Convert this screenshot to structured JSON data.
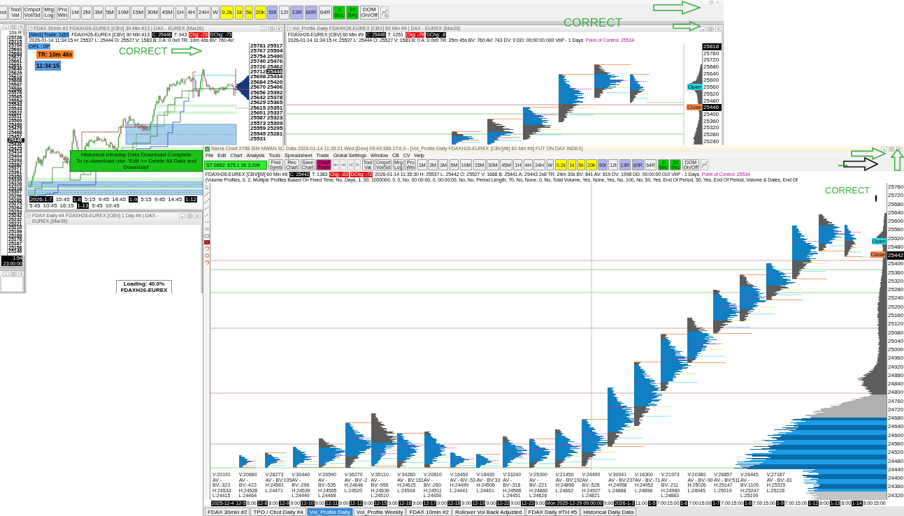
{
  "app_toolbar": {
    "buttons": [
      {
        "label": "nd",
        "color": "#f0f0f0"
      },
      {
        "label": "Tool Val",
        "color": "#f0f0f0"
      },
      {
        "label": "Cmpct Vol/Sd",
        "color": "#f0f0f0"
      },
      {
        "label": "Mrg Log",
        "color": "#f0f0f0"
      },
      {
        "label": "Pro Win",
        "color": "#f0f0f0"
      },
      {
        "label": "1M",
        "color": "#f0f0f0"
      },
      {
        "label": "2M",
        "color": "#f0f0f0"
      },
      {
        "label": "3M",
        "color": "#f0f0f0"
      },
      {
        "label": "5M",
        "color": "#f0f0f0"
      },
      {
        "label": "10M",
        "color": "#f0f0f0"
      },
      {
        "label": "15M",
        "color": "#f0f0f0"
      },
      {
        "label": "30M",
        "color": "#f0f0f0"
      },
      {
        "label": "45M",
        "color": "#f0f0f0"
      },
      {
        "label": "1H",
        "color": "#f0f0f0"
      },
      {
        "label": "4H",
        "color": "#f0f0f0"
      },
      {
        "label": "24H",
        "color": "#f0f0f0"
      },
      {
        "label": "W",
        "color": "#f0f0f0"
      },
      {
        "label": "0.2k",
        "color": "#ffff00"
      },
      {
        "label": "1k",
        "color": "#ffff00"
      },
      {
        "label": "5k",
        "color": "#ffff00"
      },
      {
        "label": "20k",
        "color": "#ffff00"
      },
      {
        "label": "50t",
        "color": "#b4b4f0"
      },
      {
        "label": "12t",
        "color": "#f0f0f0"
      },
      {
        "label": "13R",
        "color": "#b4b4f0"
      },
      {
        "label": "60R",
        "color": "#b4b4f0"
      },
      {
        "label": "64R",
        "color": "#f0f0f0"
      },
      {
        "label": "3 Sec",
        "color": "#00d000"
      },
      {
        "label": "10 Sec",
        "color": "#00d000"
      },
      {
        "label": "DOM On/Off",
        "color": "#f0f0f0"
      }
    ]
  },
  "ladder_window": {
    "header": "10s R",
    "prices": [
      {
        "label": "25726",
        "highlighted": false
      },
      {
        "label": "25715",
        "highlighted": false
      },
      {
        "label": "25704",
        "highlighted": false
      },
      {
        "label": "25693",
        "highlighted": false
      },
      {
        "label": "25683",
        "highlighted": false
      },
      {
        "label": "25672",
        "highlighted": false
      },
      {
        "label": "25661",
        "highlighted": false
      },
      {
        "label": "25651",
        "highlighted": false
      },
      {
        "label": "25640",
        "highlighted": false
      },
      {
        "label": "25629",
        "highlighted": false
      },
      {
        "label": "25619",
        "highlighted": false
      },
      {
        "label": "25608",
        "highlighted": false
      },
      {
        "label": "25597",
        "highlighted": false
      },
      {
        "label": "25586",
        "highlighted": false
      },
      {
        "label": "25576",
        "highlighted": false
      },
      {
        "label": "25565",
        "highlighted": false
      },
      {
        "label": "25554",
        "highlighted": false
      },
      {
        "label": "25543",
        "highlighted": false
      },
      {
        "label": "25533",
        "highlighted": false
      },
      {
        "label": "25522",
        "highlighted": false
      },
      {
        "label": "25511",
        "highlighted": false
      },
      {
        "label": "25500",
        "highlighted": false
      },
      {
        "label": "25490",
        "highlighted": false
      },
      {
        "label": "25479",
        "highlighted": false
      },
      {
        "label": "25468",
        "highlighted": false
      },
      {
        "label": "25457",
        "highlighted": false
      },
      {
        "label": "25446",
        "highlighted": true
      },
      {
        "label": "25436",
        "highlighted": false
      },
      {
        "label": "25425",
        "highlighted": false
      },
      {
        "label": "25414",
        "highlighted": false
      },
      {
        "label": "25404",
        "highlighted": false
      },
      {
        "label": "25393",
        "highlighted": false
      },
      {
        "label": "25382",
        "highlighted": false
      },
      {
        "label": "25371",
        "highlighted": false
      },
      {
        "label": "25361",
        "highlighted": false
      },
      {
        "label": "25350",
        "highlighted": false
      },
      {
        "label": "25339",
        "highlighted": false
      },
      {
        "label": "25328",
        "highlighted": false
      },
      {
        "label": "25318",
        "highlighted": false
      },
      {
        "label": "25307",
        "highlighted": false
      },
      {
        "label": "25296",
        "highlighted": false
      },
      {
        "label": "25285",
        "highlighted": false
      },
      {
        "label": "25275",
        "highlighted": false
      },
      {
        "label": "25264",
        "highlighted": false
      },
      {
        "label": "25253",
        "highlighted": false
      },
      {
        "label": "25242",
        "highlighted": false
      },
      {
        "label": "25232",
        "highlighted": false
      },
      {
        "label": "25221",
        "highlighted": false
      },
      {
        "label": "25210",
        "highlighted": false
      },
      {
        "label": "25199",
        "highlighted": false
      },
      {
        "label": "25189",
        "highlighted": false
      },
      {
        "label": "25178",
        "highlighted": false
      },
      {
        "label": "25167",
        "highlighted": false
      },
      {
        "label": "25156",
        "highlighted": false
      },
      {
        "label": "25146",
        "highlighted": false
      }
    ],
    "footer": "1:54 23:00:00"
  },
  "chart_window": {
    "title": "FDAX 30min #2 FDAXH26-EUREX [CBV]  30 Min #13 | DAX - EUREX (Mar26)",
    "header": [
      {
        "kind": "account",
        "text": "[Sim1]  Trade: 1@0"
      },
      {
        "kind": "text",
        "text": "FDAXH26-EUREX [CBV]  30 Min #13"
      },
      {
        "kind": "price",
        "text": "C: 25446"
      },
      {
        "kind": "text",
        "text": "T: 943"
      },
      {
        "kind": "change",
        "text": "Chg: -73"
      },
      {
        "kind": "price",
        "text": "DChg: -73"
      },
      {
        "kind": "text",
        "text": "2026-01-14 11:34:15 H: 25537 L: 25444 O: 25527 V: 1583 B: 0 A: 0 0x0 TR: 10m 46s BV: 760 AV:"
      }
    ],
    "account_pnl": "OPL: 0P",
    "timer": "TR: 10m 46s",
    "clock": "11:34:15",
    "notice": [
      "Historical Intraday Data Download Complete",
      "To re-download use: 'Edit >> Delete All Data and Download'"
    ],
    "price_axis": [
      {
        "label": "25781",
        "highlighted": false
      },
      {
        "label": "25767",
        "highlighted": false
      },
      {
        "label": "25754",
        "highlighted": false
      },
      {
        "label": "25740",
        "highlighted": false
      },
      {
        "label": "25726",
        "highlighted": false
      },
      {
        "label": "25712",
        "highlighted": false
      },
      {
        "label": "25698",
        "highlighted": false
      },
      {
        "label": "25684",
        "highlighted": false
      },
      {
        "label": "25670",
        "highlighted": false
      },
      {
        "label": "25656",
        "highlighted": false
      },
      {
        "label": "25642",
        "highlighted": false
      },
      {
        "label": "25629",
        "highlighted": false
      },
      {
        "label": "25615",
        "highlighted": false
      },
      {
        "label": "25601",
        "highlighted": false
      },
      {
        "label": "25587",
        "highlighted": false
      },
      {
        "label": "25573",
        "highlighted": false
      },
      {
        "label": "25559",
        "highlighted": false
      },
      {
        "label": "25545",
        "highlighted": false
      },
      {
        "label": "25531",
        "highlighted": false
      },
      {
        "label": "25517",
        "highlighted": false
      },
      {
        "label": "25504",
        "highlighted": false
      },
      {
        "label": "25490",
        "highlighted": false
      },
      {
        "label": "25476",
        "highlighted": false
      },
      {
        "label": "25462",
        "highlighted": false
      },
      {
        "label": "25446",
        "highlighted": true
      },
      {
        "label": "25434",
        "highlighted": false
      },
      {
        "label": "25420",
        "highlighted": false
      },
      {
        "label": "25406",
        "highlighted": false
      },
      {
        "label": "25392",
        "highlighted": false
      },
      {
        "label": "25378",
        "highlighted": false
      },
      {
        "label": "25365",
        "highlighted": false
      },
      {
        "label": "25351",
        "highlighted": false
      },
      {
        "label": "25337",
        "highlighted": false
      },
      {
        "label": "25323",
        "highlighted": false
      },
      {
        "label": "25309",
        "highlighted": false
      },
      {
        "label": "25295",
        "highlighted": false
      },
      {
        "label": "25281",
        "highlighted": false
      }
    ],
    "time_axis": [
      {
        "label": "2026-1-7",
        "kind": "date"
      },
      {
        "label": "15:45",
        "kind": "time"
      },
      {
        "label": "1-8",
        "kind": "date"
      },
      {
        "label": "5:15",
        "kind": "time"
      },
      {
        "label": "9:45",
        "kind": "time"
      },
      {
        "label": "14:45",
        "kind": "time"
      },
      {
        "label": "1-9",
        "kind": "date"
      },
      {
        "label": "5:15",
        "kind": "time"
      },
      {
        "label": "9:45",
        "kind": "time"
      },
      {
        "label": "14:45",
        "kind": "time"
      },
      {
        "label": "1-12",
        "kind": "date"
      },
      {
        "label": "5:45",
        "kind": "time"
      },
      {
        "label": "10:45",
        "kind": "time"
      },
      {
        "label": "16:15",
        "kind": "time"
      },
      {
        "label": "1-13",
        "kind": "date"
      },
      {
        "label": "5:45",
        "kind": "time"
      },
      {
        "label": "10:45",
        "kind": "time"
      }
    ]
  },
  "profile_window": {
    "title": "Vol_Profile Daily FDAXH26-EUREX [CBV]  60 Min #9 | DAX - EUREX (Mar26)",
    "header": [
      {
        "kind": "text",
        "text": "FDAXH26-EUREX [CBV]  60 Min #9"
      },
      {
        "kind": "price",
        "text": "C: 25446"
      },
      {
        "kind": "text",
        "text": "T: 1251"
      },
      {
        "kind": "change",
        "text": "Chg: -79"
      },
      {
        "kind": "price",
        "text": "DChg: -8"
      },
      {
        "kind": "text",
        "text": "2026-01-14 11:34:15 H: 25537 L: 25444 O: 25527 V: 1583 B: 0 A: 0 0x0 TR: 25m 45s BV: 760 AV: 743 DV: 0 DD: 00:00:00.000 VbP - 1 Days"
      },
      {
        "kind": "poc",
        "text": "Point of Control: 25534"
      }
    ],
    "open_tag": "Open",
    "close_tag": "Close",
    "price_axis": [
      {
        "label": "25818",
        "highlighted": true
      },
      {
        "label": "25760",
        "highlighted": false
      },
      {
        "label": "25720",
        "highlighted": false
      },
      {
        "label": "25680",
        "highlighted": false
      },
      {
        "label": "25640",
        "highlighted": false
      },
      {
        "label": "25600",
        "highlighted": false
      },
      {
        "label": "25560",
        "highlighted": false
      },
      {
        "label": "25520",
        "highlighted": false
      },
      {
        "label": "25480",
        "highlighted": false
      },
      {
        "label": "25446",
        "highlighted": true
      },
      {
        "label": "25400",
        "highlighted": false
      },
      {
        "label": "25360",
        "highlighted": false
      },
      {
        "label": "25320",
        "highlighted": false
      },
      {
        "label": "25280",
        "highlighted": false
      },
      {
        "label": "25240",
        "highlighted": false
      }
    ]
  },
  "loading_window": {
    "title": "FDAX Daily #4 FDAXH26-EUREX [CBV]  1 Day #4 | DAX - EUREX (Mar26)",
    "message": "Loading: 40.0%",
    "detail": "FDAXH26-EUREX"
  },
  "main_window": {
    "title": "Sierra Chart 2788 SIM MWAN SC Data 2026-01-14 11:35:21 Wed [Dow] 09:49:386 1T:6.9 - [Vol_Profile Daily FDAXH26-EUREX [CBV]#6] 60 Min #6] FUT ON DAX INDEX]",
    "menu": [
      "File",
      "Edit",
      "Chart",
      "Analysis",
      "Tools",
      "Spreadsheet",
      "Trade",
      "Global Settings",
      "Window",
      "CB",
      "CV",
      "Help"
    ],
    "quote_field": "ST 0852: 675.1 00 3.009",
    "toolbar": [
      {
        "label": "Find Symb",
        "color": "#f0f0f0"
      },
      {
        "label": "Rec Chart",
        "color": "#f0f0f0"
      },
      {
        "label": "Save Chart",
        "color": "#f0f0f0"
      },
      {
        "label": "Chart Trade",
        "color": "#c8106e"
      },
      {
        "label": "Tool Val",
        "color": "#f0f0f0"
      },
      {
        "label": "Cmpct Vol/Sd",
        "color": "#f0f0f0"
      },
      {
        "label": "Mrg Log",
        "color": "#f0f0f0"
      },
      {
        "label": "Pro Win",
        "color": "#f0f0f0"
      },
      {
        "label": "1M",
        "color": "#f0f0f0"
      },
      {
        "label": "2M",
        "color": "#f0f0f0"
      },
      {
        "label": "3M",
        "color": "#f0f0f0"
      },
      {
        "label": "5M",
        "color": "#f0f0f0"
      },
      {
        "label": "10M",
        "color": "#f0f0f0"
      },
      {
        "label": "15M",
        "color": "#f0f0f0"
      },
      {
        "label": "30M",
        "color": "#f0f0f0"
      },
      {
        "label": "45M",
        "color": "#f0f0f0"
      },
      {
        "label": "1H",
        "color": "#f0f0f0"
      },
      {
        "label": "4H",
        "color": "#f0f0f0"
      },
      {
        "label": "24H",
        "color": "#f0f0f0"
      },
      {
        "label": "W",
        "color": "#f0f0f0"
      },
      {
        "label": "0.2k",
        "color": "#ffff00"
      },
      {
        "label": "1k",
        "color": "#ffff00"
      },
      {
        "label": "5k",
        "color": "#ffff00"
      },
      {
        "label": "20k",
        "color": "#ffff00"
      },
      {
        "label": "50t",
        "color": "#b4b4f0"
      },
      {
        "label": "12t",
        "color": "#f0f0f0"
      },
      {
        "label": "13R",
        "color": "#b4b4f0"
      },
      {
        "label": "60R",
        "color": "#b4b4f0"
      },
      {
        "label": "64R",
        "color": "#f0f0f0"
      },
      {
        "label": "3 Sec",
        "color": "#00d000"
      },
      {
        "label": "10 Sec",
        "color": "#00d000"
      },
      {
        "label": "DOM On/Off",
        "color": "#f0f0f0"
      }
    ],
    "header": [
      {
        "kind": "text",
        "text": "FDAXH26-EUREX [CBV][M]  60 Min #6"
      },
      {
        "kind": "price",
        "text": "C: 25442"
      },
      {
        "kind": "text",
        "text": "T: 1383"
      },
      {
        "kind": "change",
        "text": "Chg: -83"
      },
      {
        "kind": "change",
        "text": "DChg: -72"
      },
      {
        "kind": "text",
        "text": "2026-01-14 11:35:30 H: 25537 L: 25442 O: 25527 V: 1668 B: 25441 A: 25443 2x8 TR: 24m 30s BV: 841 AV: 819 DV: 1998 DD: 00:00:00.010 VbP - 1 Days"
      },
      {
        "kind": "poc",
        "text": "Point of Control: 25534"
      },
      {
        "kind": "text",
        "text": "(Volume Profiles, 0, 2, Multiple Profiles Based On Fixed Time, No, Days, 1, 30, 1000000, 0, 0, No, 00:00:00, 0, 00:00:00, No, No, Period Length, 70, No, None, 0, No, Total Volume, Yes, None, Yes, No, 100, No, 50, Yes, End Of Period, 50, Yes, End Of Period, Volume & Dates, End Of"
      }
    ],
    "open_tag": "Open",
    "close_tag": "Close",
    "profile_stats": [
      {
        "volume": "V:20191",
        "delta": "AV - BV:-323",
        "high": "H:24533",
        "low": "L:24415"
      },
      {
        "volume": "V:20660",
        "delta": "AV - BV:-423",
        "high": "H:24528",
        "low": "L:24464"
      },
      {
        "volume": "V:28273",
        "delta": "AV - BV:105",
        "high": "H:24561",
        "low": "L:24471"
      },
      {
        "volume": "V:30440",
        "delta": "AV - BV:-296",
        "high": "H:24539",
        "low": "L:24440"
      },
      {
        "volume": "V:26590",
        "delta": "AV - BV:-535",
        "high": "H:24565",
        "low": "L:24468"
      },
      {
        "volume": "V:36270",
        "delta": "AV - BV:-2",
        "high": "H:24646",
        "low": "L:24520"
      },
      {
        "volume": "V:35110",
        "delta": "AV - BV:-956",
        "high": "H:24636",
        "low": "L:24510"
      },
      {
        "volume": "V:34280",
        "delta": "AV - BV:161",
        "high": "H:24615",
        "low": "L:24504"
      },
      {
        "volume": "V:20810",
        "delta": "AV - BV:-260",
        "high": "H:24511",
        "low": "L:24450"
      },
      {
        "volume": "V:16450",
        "delta": "AV - BV:-53",
        "high": "H:24499",
        "low": "L:24441"
      },
      {
        "volume": "V:18430",
        "delta": "AV - BV:33",
        "high": "H:24506",
        "low": "L:24461"
      },
      {
        "volume": "V:33240",
        "delta": "AV - BV:-316",
        "high": "H:24566",
        "low": "L:24451"
      },
      {
        "volume": "V:25390",
        "delta": "AV - BV:-221",
        "high": "H:24860",
        "low": "L:24626"
      },
      {
        "volume": "V:21450",
        "delta": "AV - BV:192",
        "high": "H:24856",
        "low": "L:24662"
      },
      {
        "volume": "V:24490",
        "delta": "AV - BV:-528",
        "high": "H:24927",
        "low": "L:24821"
      },
      {
        "volume": "V:30041",
        "delta": "AV - BV:237",
        "high": "H:24958",
        "low": "L:24888"
      },
      {
        "volume": "V:16300",
        "delta": "AV - BV:-71",
        "high": "H:24952",
        "low": "L:24896"
      },
      {
        "volume": "V:21973",
        "delta": "AV - BV:-211",
        "high": "H:24960",
        "low": "L:24883"
      },
      {
        "volume": "V:20380",
        "delta": "AV - BV:-90",
        "high": "H:25026",
        "low": "L:24945"
      },
      {
        "volume": "V:26857",
        "delta": "AV - BV:511",
        "high": "H:25147",
        "low": "L:25019"
      },
      {
        "volume": "V:26445",
        "delta": "AV - BV:1105",
        "high": "H:25247",
        "low": "L:25100"
      },
      {
        "volume": "V:27187",
        "delta": "AV - BV:-61",
        "high": "H:25315",
        "low": "L:25228"
      }
    ],
    "price_axis": [
      {
        "label": "25760",
        "highlighted": false
      },
      {
        "label": "25720",
        "highlighted": false
      },
      {
        "label": "25680",
        "highlighted": false
      },
      {
        "label": "25640",
        "highlighted": false
      },
      {
        "label": "25600",
        "highlighted": false
      },
      {
        "label": "25560",
        "highlighted": false
      },
      {
        "label": "25520",
        "highlighted": false
      },
      {
        "label": "25480",
        "highlighted": false
      },
      {
        "label": "25442",
        "highlighted": true
      },
      {
        "label": "25400",
        "highlighted": false
      },
      {
        "label": "25360",
        "highlighted": false
      },
      {
        "label": "25320",
        "highlighted": false
      },
      {
        "label": "25280",
        "highlighted": false
      },
      {
        "label": "25240",
        "highlighted": false
      },
      {
        "label": "25200",
        "highlighted": false
      },
      {
        "label": "25160",
        "highlighted": false
      },
      {
        "label": "25120",
        "highlighted": false
      },
      {
        "label": "25080",
        "highlighted": false
      },
      {
        "label": "25040",
        "highlighted": false
      },
      {
        "label": "25000",
        "highlighted": false
      },
      {
        "label": "24960",
        "highlighted": false
      },
      {
        "label": "24920",
        "highlighted": false
      },
      {
        "label": "24880",
        "highlighted": false
      },
      {
        "label": "24840",
        "highlighted": false
      },
      {
        "label": "24800",
        "highlighted": false
      },
      {
        "label": "24760",
        "highlighted": false
      },
      {
        "label": "24720",
        "highlighted": false
      },
      {
        "label": "24680",
        "highlighted": false
      },
      {
        "label": "24640",
        "highlighted": false
      },
      {
        "label": "24600",
        "highlighted": false
      },
      {
        "label": "24560",
        "highlighted": false
      },
      {
        "label": "24520",
        "highlighted": false
      },
      {
        "label": "24480",
        "highlighted": false
      },
      {
        "label": "24440",
        "highlighted": false
      },
      {
        "label": "24400",
        "highlighted": false
      },
      {
        "label": "24360",
        "highlighted": false
      },
      {
        "label": "24320",
        "highlighted": false
      }
    ],
    "time_axis": [
      {
        "label": "2025-12-4",
        "kind": "date"
      },
      {
        "label": "12-5",
        "kind": "date"
      },
      {
        "label": "8:00",
        "kind": "time"
      },
      {
        "label": "12-8",
        "kind": "date"
      },
      {
        "label": "8:00",
        "kind": "time"
      },
      {
        "label": "12-9",
        "kind": "date"
      },
      {
        "label": "9:00",
        "kind": "time"
      },
      {
        "label": "12-10",
        "kind": "date"
      },
      {
        "label": "9:00",
        "kind": "time"
      },
      {
        "label": "12-11",
        "kind": "date"
      },
      {
        "label": "9:00",
        "kind": "time"
      },
      {
        "label": "12-12",
        "kind": "date"
      },
      {
        "label": "9:00",
        "kind": "time"
      },
      {
        "label": "12-15",
        "kind": "date"
      },
      {
        "label": "9:00",
        "kind": "time"
      },
      {
        "label": "12-16",
        "kind": "date"
      },
      {
        "label": "9:00",
        "kind": "time"
      },
      {
        "label": "12-17",
        "kind": "date"
      },
      {
        "label": "9:00",
        "kind": "time"
      },
      {
        "label": "12-18",
        "kind": "date"
      },
      {
        "label": "9:00",
        "kind": "time"
      },
      {
        "label": "12-19",
        "kind": "date"
      },
      {
        "label": "9:00",
        "kind": "time"
      },
      {
        "label": "12-22",
        "kind": "date"
      },
      {
        "label": "9:00",
        "kind": "time"
      },
      {
        "label": "12-23",
        "kind": "date"
      },
      {
        "label": "9:00",
        "kind": "time"
      },
      {
        "label": "Mon 2025-12-29 09:00:00",
        "kind": "cursor"
      },
      {
        "label": "9:00",
        "kind": "time"
      },
      {
        "label": "2026-1-2",
        "kind": "date"
      },
      {
        "label": "11:00",
        "kind": "time"
      },
      {
        "label": "1-5",
        "kind": "date"
      },
      {
        "label": "7:00",
        "kind": "time"
      },
      {
        "label": "15:00",
        "kind": "time"
      },
      {
        "label": "1-6",
        "kind": "date"
      },
      {
        "label": "7:00",
        "kind": "time"
      },
      {
        "label": "15:00",
        "kind": "time"
      },
      {
        "label": "1-7",
        "kind": "date"
      },
      {
        "label": "7:00",
        "kind": "time"
      },
      {
        "label": "15:00",
        "kind": "time"
      },
      {
        "label": "1-8",
        "kind": "date"
      },
      {
        "label": "7:00",
        "kind": "time"
      },
      {
        "label": "15:00",
        "kind": "time"
      },
      {
        "label": "1-9",
        "kind": "date"
      },
      {
        "label": "7:00",
        "kind": "time"
      },
      {
        "label": "15:00",
        "kind": "time"
      },
      {
        "label": "1-12",
        "kind": "date"
      },
      {
        "label": "8:00",
        "kind": "time"
      },
      {
        "label": "1-13",
        "kind": "date"
      },
      {
        "label": "8:00",
        "kind": "time"
      },
      {
        "label": "1-14",
        "kind": "date"
      },
      {
        "label": "8:00",
        "kind": "time"
      },
      {
        "label": "15:00",
        "kind": "time"
      }
    ],
    "tabs": [
      {
        "label": "FDAX 30min #2",
        "selected": false
      },
      {
        "label": "TPO / Cbot Daily #4",
        "selected": false
      },
      {
        "label": "Vol_Profile Daily",
        "selected": true
      },
      {
        "label": "Vol_Profile Weekly",
        "selected": false
      },
      {
        "label": "FDAX 10min #2",
        "selected": false
      },
      {
        "label": "Rollover Vol Back Adjusted",
        "selected": false
      },
      {
        "label": "FDAX Daily #TH #5",
        "selected": false
      },
      {
        "label": "Historical Daily Data",
        "selected": false
      }
    ]
  },
  "annotations": [
    "CORRECT",
    "CORRECT",
    "CORRECT"
  ]
}
